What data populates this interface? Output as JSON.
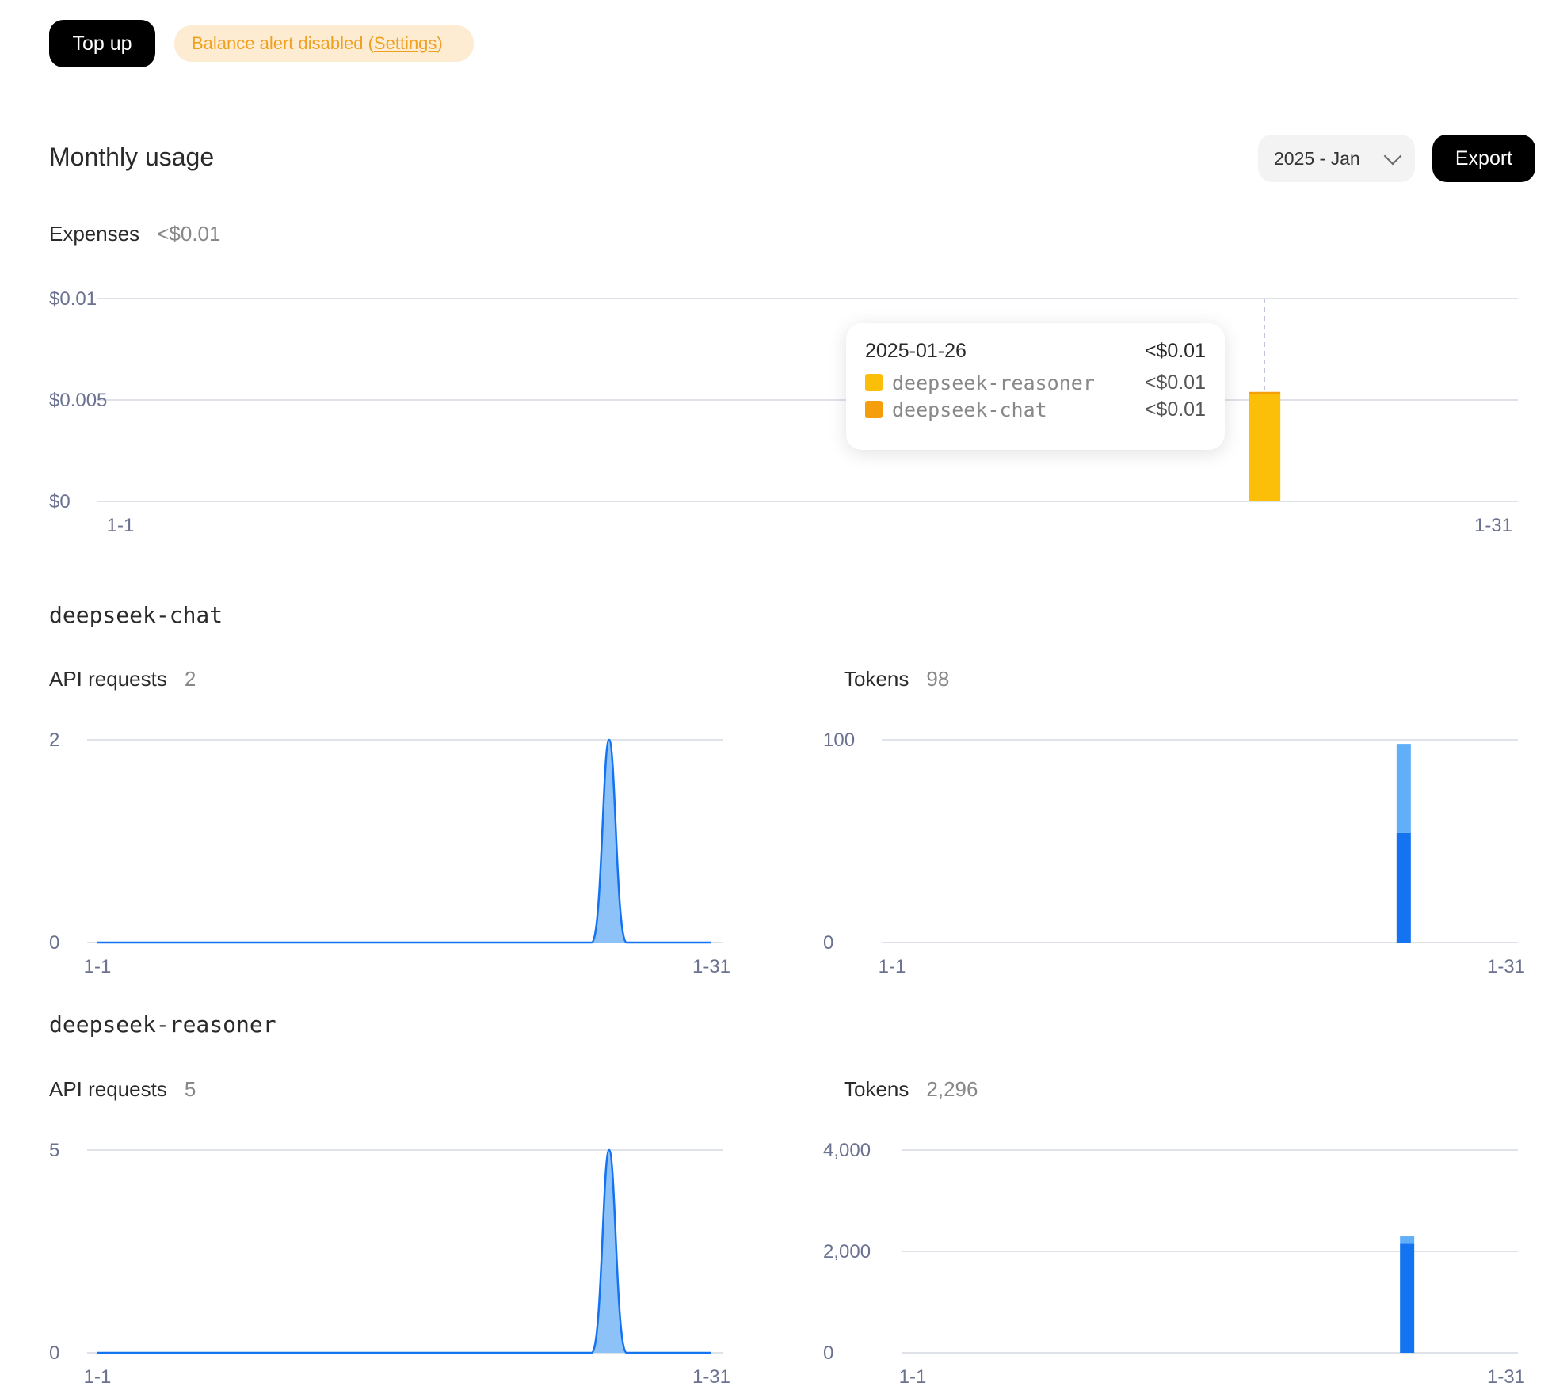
{
  "top_bar": {
    "topup_label": "Top up",
    "alert_text": "Balance alert disabled (",
    "alert_link": "Settings",
    "alert_close": ")"
  },
  "monthly": {
    "title": "Monthly usage",
    "month_selected": "2025 - Jan",
    "export_label": "Export",
    "expenses_label": "Expenses",
    "expenses_value": "<$0.01"
  },
  "tooltip": {
    "date": "2025-01-26",
    "total": "<$0.01",
    "rows": [
      {
        "name": "deepseek-reasoner",
        "value": "<$0.01",
        "color": "#fbbf0a"
      },
      {
        "name": "deepseek-chat",
        "value": "<$0.01",
        "color": "#f59e0b"
      }
    ]
  },
  "models": [
    {
      "name": "deepseek-chat",
      "requests_label": "API requests",
      "requests_value": "2",
      "tokens_label": "Tokens",
      "tokens_value": "98"
    },
    {
      "name": "deepseek-reasoner",
      "requests_label": "API requests",
      "requests_value": "5",
      "tokens_label": "Tokens",
      "tokens_value": "2,296"
    }
  ],
  "colors": {
    "bar_yellow": "#fbbf0a",
    "blue_dark": "#1473f0",
    "blue_light": "#60aff8",
    "area_fill": "#8cc2f7"
  },
  "chart_data": [
    {
      "id": "expenses",
      "type": "bar",
      "stacked": true,
      "title": "Expenses",
      "x_start": "1-1",
      "x_end": "1-31",
      "ylim": [
        0,
        0.01
      ],
      "yticks": [
        {
          "v": 0,
          "label": "$0"
        },
        {
          "v": 0.005,
          "label": "$0.005"
        },
        {
          "v": 0.01,
          "label": "$0.01"
        }
      ],
      "series": [
        {
          "name": "deepseek-reasoner",
          "color": "#fbbf0a",
          "points": [
            {
              "day": 26,
              "value": 0.0053
            }
          ]
        },
        {
          "name": "deepseek-chat",
          "color": "#f59e0b",
          "points": [
            {
              "day": 26,
              "value": 0.0001
            }
          ]
        }
      ],
      "highlight_day": 26
    },
    {
      "id": "chat_requests",
      "type": "area",
      "title": "API requests",
      "x_start": "1-1",
      "x_end": "1-31",
      "ylim": [
        0,
        2
      ],
      "yticks": [
        {
          "v": 0,
          "label": "0"
        },
        {
          "v": 2,
          "label": "2"
        }
      ],
      "points": [
        {
          "day": 26,
          "value": 2
        }
      ]
    },
    {
      "id": "chat_tokens",
      "type": "bar",
      "stacked": true,
      "title": "Tokens",
      "x_start": "1-1",
      "x_end": "1-31",
      "ylim": [
        0,
        100
      ],
      "yticks": [
        {
          "v": 0,
          "label": "0"
        },
        {
          "v": 100,
          "label": "100"
        }
      ],
      "series": [
        {
          "color": "#1473f0",
          "points": [
            {
              "day": 26,
              "value": 54
            }
          ]
        },
        {
          "color": "#60aff8",
          "points": [
            {
              "day": 26,
              "value": 44
            }
          ]
        }
      ]
    },
    {
      "id": "reasoner_requests",
      "type": "area",
      "title": "API requests",
      "x_start": "1-1",
      "x_end": "1-31",
      "ylim": [
        0,
        5
      ],
      "yticks": [
        {
          "v": 0,
          "label": "0"
        },
        {
          "v": 5,
          "label": "5"
        }
      ],
      "points": [
        {
          "day": 26,
          "value": 5
        }
      ]
    },
    {
      "id": "reasoner_tokens",
      "type": "bar",
      "stacked": true,
      "title": "Tokens",
      "x_start": "1-1",
      "x_end": "1-31",
      "ylim": [
        0,
        4000
      ],
      "yticks": [
        {
          "v": 0,
          "label": "0"
        },
        {
          "v": 2000,
          "label": "2,000"
        },
        {
          "v": 4000,
          "label": "4,000"
        }
      ],
      "series": [
        {
          "color": "#1473f0",
          "points": [
            {
              "day": 26,
              "value": 2166
            }
          ]
        },
        {
          "color": "#60aff8",
          "points": [
            {
              "day": 26,
              "value": 130
            }
          ]
        }
      ]
    }
  ]
}
